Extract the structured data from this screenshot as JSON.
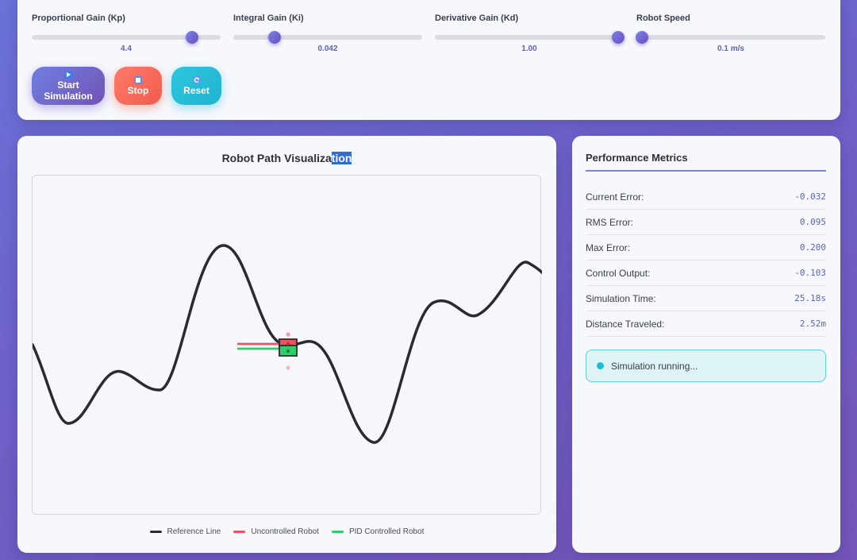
{
  "controls": {
    "sliders": [
      {
        "label": "Proportional Gain (Kp)",
        "value": "4.4",
        "fraction": 0.85
      },
      {
        "label": "Integral Gain (Ki)",
        "value": "0.042",
        "fraction": 0.22
      },
      {
        "label": "Derivative Gain (Kd)",
        "value": "1.00",
        "fraction": 0.97
      },
      {
        "label": "Robot Speed",
        "value": "0.1 m/s",
        "fraction": 0.03
      }
    ],
    "buttons": {
      "start_line1": "Start",
      "start_line2": "Simulation",
      "stop": "Stop",
      "reset": "Reset"
    }
  },
  "viz": {
    "title_part1": "Robot Path Visualiza",
    "title_part2": "tion",
    "legend": {
      "reference": "Reference Line",
      "uncontrolled": "Uncontrolled Robot",
      "pid": "PID Controlled Robot"
    },
    "colors": {
      "reference": "#2b2b2f",
      "uncontrolled": "#f0515f",
      "pid": "#2fce6a"
    }
  },
  "metrics": {
    "title": "Performance Metrics",
    "rows": [
      {
        "label": "Current Error:",
        "value": "-0.032"
      },
      {
        "label": "RMS Error:",
        "value": "0.095"
      },
      {
        "label": "Max Error:",
        "value": "0.200"
      },
      {
        "label": "Control Output:",
        "value": "-0.103"
      },
      {
        "label": "Simulation Time:",
        "value": "25.18s"
      },
      {
        "label": "Distance Traveled:",
        "value": "2.52m"
      }
    ],
    "status": "Simulation running..."
  }
}
